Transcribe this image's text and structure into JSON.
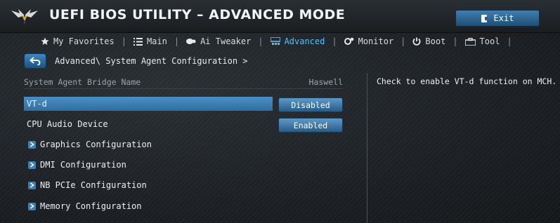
{
  "title": "UEFI BIOS UTILITY – ADVANCED MODE",
  "exit_label": "Exit",
  "tabs": [
    {
      "label": "My Favorites",
      "icon": "star-icon",
      "active": false
    },
    {
      "label": "Main",
      "icon": "list-icon",
      "active": false
    },
    {
      "label": "Ai Tweaker",
      "icon": "tweaker-icon",
      "active": false
    },
    {
      "label": "Advanced",
      "icon": "advanced-icon",
      "active": true
    },
    {
      "label": "Monitor",
      "icon": "monitor-icon",
      "active": false
    },
    {
      "label": "Boot",
      "icon": "power-icon",
      "active": false
    },
    {
      "label": "Tool",
      "icon": "tool-icon",
      "active": false
    }
  ],
  "breadcrumb": "Advanced\\ System Agent Configuration >",
  "system_agent": {
    "label": "System Agent Bridge Name",
    "value": "Haswell"
  },
  "settings": [
    {
      "label": "VT-d",
      "value": "Disabled",
      "selected": true
    },
    {
      "label": "CPU Audio Device",
      "value": "Enabled",
      "selected": false
    }
  ],
  "submenus": [
    {
      "label": "Graphics Configuration"
    },
    {
      "label": "DMI Configuration"
    },
    {
      "label": "NB PCIe Configuration"
    },
    {
      "label": "Memory Configuration"
    }
  ],
  "help_text": "Check to enable VT-d function on MCH.",
  "colors": {
    "accent": "#4fc3ff",
    "selected_row": "#3d80b5",
    "button": "#3f7fb3"
  }
}
